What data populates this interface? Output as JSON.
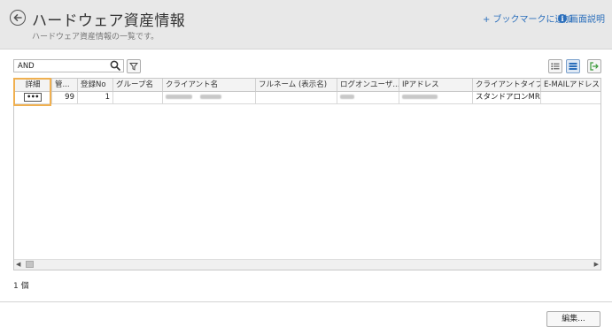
{
  "header": {
    "title": "ハードウェア資産情報",
    "subtitle": "ハードウェア資産情報の一覧です。",
    "bookmark_label": "+ ブックマークに追加",
    "help_label": "画面説明",
    "help_icon_glyph": "i"
  },
  "toolbar": {
    "search_value": "AND",
    "search_placeholder": ""
  },
  "grid": {
    "columns": [
      "詳細",
      "管...",
      "登録No",
      "グループ名",
      "クライアント名",
      "フルネーム (表示名)",
      "ログオンユーザ...",
      "IPアドレス",
      "クライアントタイプ",
      "E-MAILアドレス"
    ],
    "rows": [
      {
        "detail": "•••",
        "kanri": "99",
        "reg_no": "1",
        "group": "",
        "client_type": "スタンドアロンMR",
        "email": ""
      }
    ]
  },
  "footer": {
    "count_text": "1 個",
    "edit_label": "編集..."
  },
  "colors": {
    "accent": "#2a6ebb",
    "highlight": "#f0b050",
    "header_bg": "#e8e8e8"
  }
}
